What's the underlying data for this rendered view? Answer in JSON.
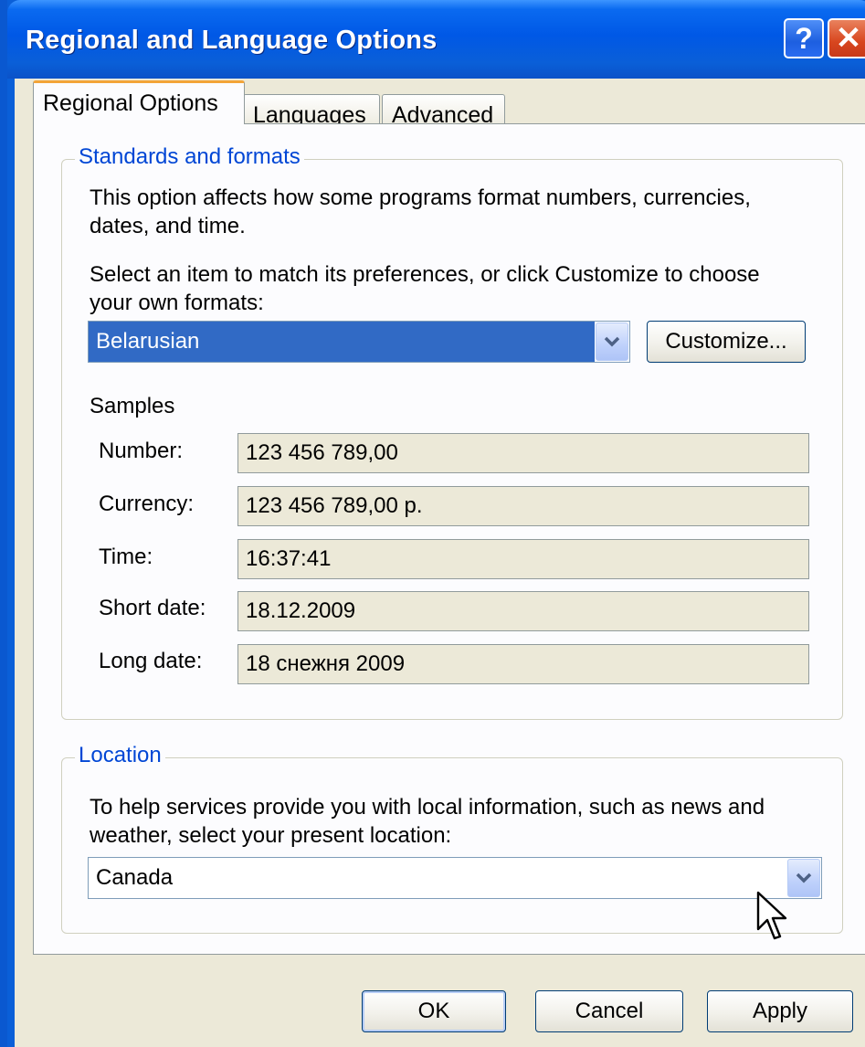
{
  "window": {
    "title": "Regional and Language Options",
    "help_glyph": "?",
    "close_glyph": "✕"
  },
  "tabs": [
    {
      "label": "Regional Options",
      "active": true
    },
    {
      "label": "Languages",
      "active": false
    },
    {
      "label": "Advanced",
      "active": false
    }
  ],
  "standards": {
    "group_title": "Standards and formats",
    "description_line1": "This option affects how some programs format numbers, currencies,",
    "description_line2": "dates, and time.",
    "instruction_line1": "Select an item to match its preferences, or click Customize to choose",
    "instruction_line2": "your own formats:",
    "format_selected": "Belarusian",
    "customize_label": "Customize...",
    "samples_label": "Samples",
    "samples": [
      {
        "label": "Number:",
        "value": "123 456 789,00"
      },
      {
        "label": "Currency:",
        "value": "123 456 789,00 p."
      },
      {
        "label": "Time:",
        "value": "16:37:41"
      },
      {
        "label": "Short date:",
        "value": "18.12.2009"
      },
      {
        "label": "Long date:",
        "value": "18 снежня 2009"
      }
    ]
  },
  "location": {
    "group_title": "Location",
    "description_line1": "To help services provide you with local information, such as news and",
    "description_line2": "weather, select your present location:",
    "selected": "Canada"
  },
  "buttons": {
    "ok": "OK",
    "cancel": "Cancel",
    "apply": "Apply"
  },
  "colors": {
    "titlebar": "#0058e6",
    "group_title": "#0046d5",
    "selection": "#316ac5",
    "tab_highlight": "#f3a438"
  }
}
